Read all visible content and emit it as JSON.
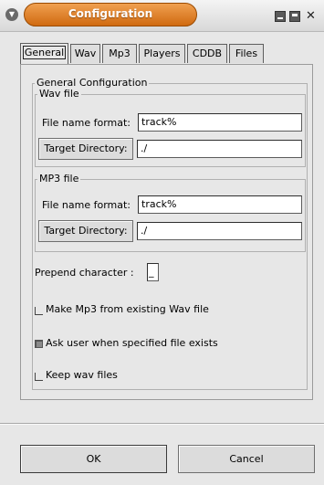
{
  "window": {
    "title": "Configuration",
    "menu_icon": "chevron-down-icon",
    "minimize_icon": "minimize-icon",
    "maximize_icon": "maximize-icon",
    "close_glyph": "✕",
    "accent_color": "#d97a1a"
  },
  "tabs": [
    {
      "label": "General",
      "active": true
    },
    {
      "label": "Wav",
      "active": false
    },
    {
      "label": "Mp3",
      "active": false
    },
    {
      "label": "Players",
      "active": false
    },
    {
      "label": "CDDB",
      "active": false
    },
    {
      "label": "Files",
      "active": false
    }
  ],
  "general": {
    "group_label": "General Configuration",
    "wav": {
      "group_label": "Wav file",
      "format_label": "File name format:",
      "format_value": "track%",
      "dir_button": "Target Directory:",
      "dir_value": "./"
    },
    "mp3": {
      "group_label": "MP3 file",
      "format_label": "File name format:",
      "format_value": "track%",
      "dir_button": "Target Directory:",
      "dir_value": "./"
    },
    "prepend_label": "Prepend character :",
    "prepend_value": "_",
    "options": [
      {
        "label": "Make Mp3 from existing Wav file",
        "checked": false
      },
      {
        "label": "Ask user when specified file exists",
        "checked": true
      },
      {
        "label": "Keep wav files",
        "checked": false
      }
    ]
  },
  "buttons": {
    "ok": "OK",
    "cancel": "Cancel"
  }
}
